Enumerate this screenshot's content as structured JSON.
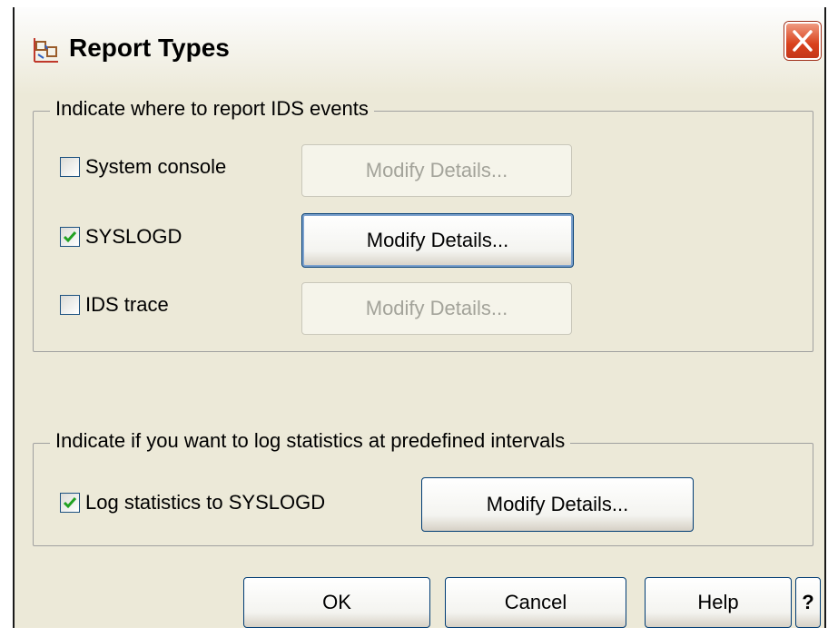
{
  "window": {
    "title": "Report Types"
  },
  "report_group": {
    "legend": "Indicate where to report IDS events",
    "rows": [
      {
        "label": "System console",
        "checked": false,
        "button": "Modify Details...",
        "enabled": false
      },
      {
        "label": "SYSLOGD",
        "checked": true,
        "button": "Modify Details...",
        "enabled": true
      },
      {
        "label": "IDS trace",
        "checked": false,
        "button": "Modify Details...",
        "enabled": false
      }
    ]
  },
  "stats_group": {
    "legend": "Indicate if you want to log statistics at predefined intervals",
    "label": "Log statistics to SYSLOGD",
    "checked": true,
    "button": "Modify Details..."
  },
  "footer": {
    "ok": "OK",
    "cancel": "Cancel",
    "help": "Help",
    "question": "?"
  },
  "colors": {
    "checkmark": "#21a121",
    "close_button": "#d9411c",
    "focus_border": "#003c74"
  }
}
